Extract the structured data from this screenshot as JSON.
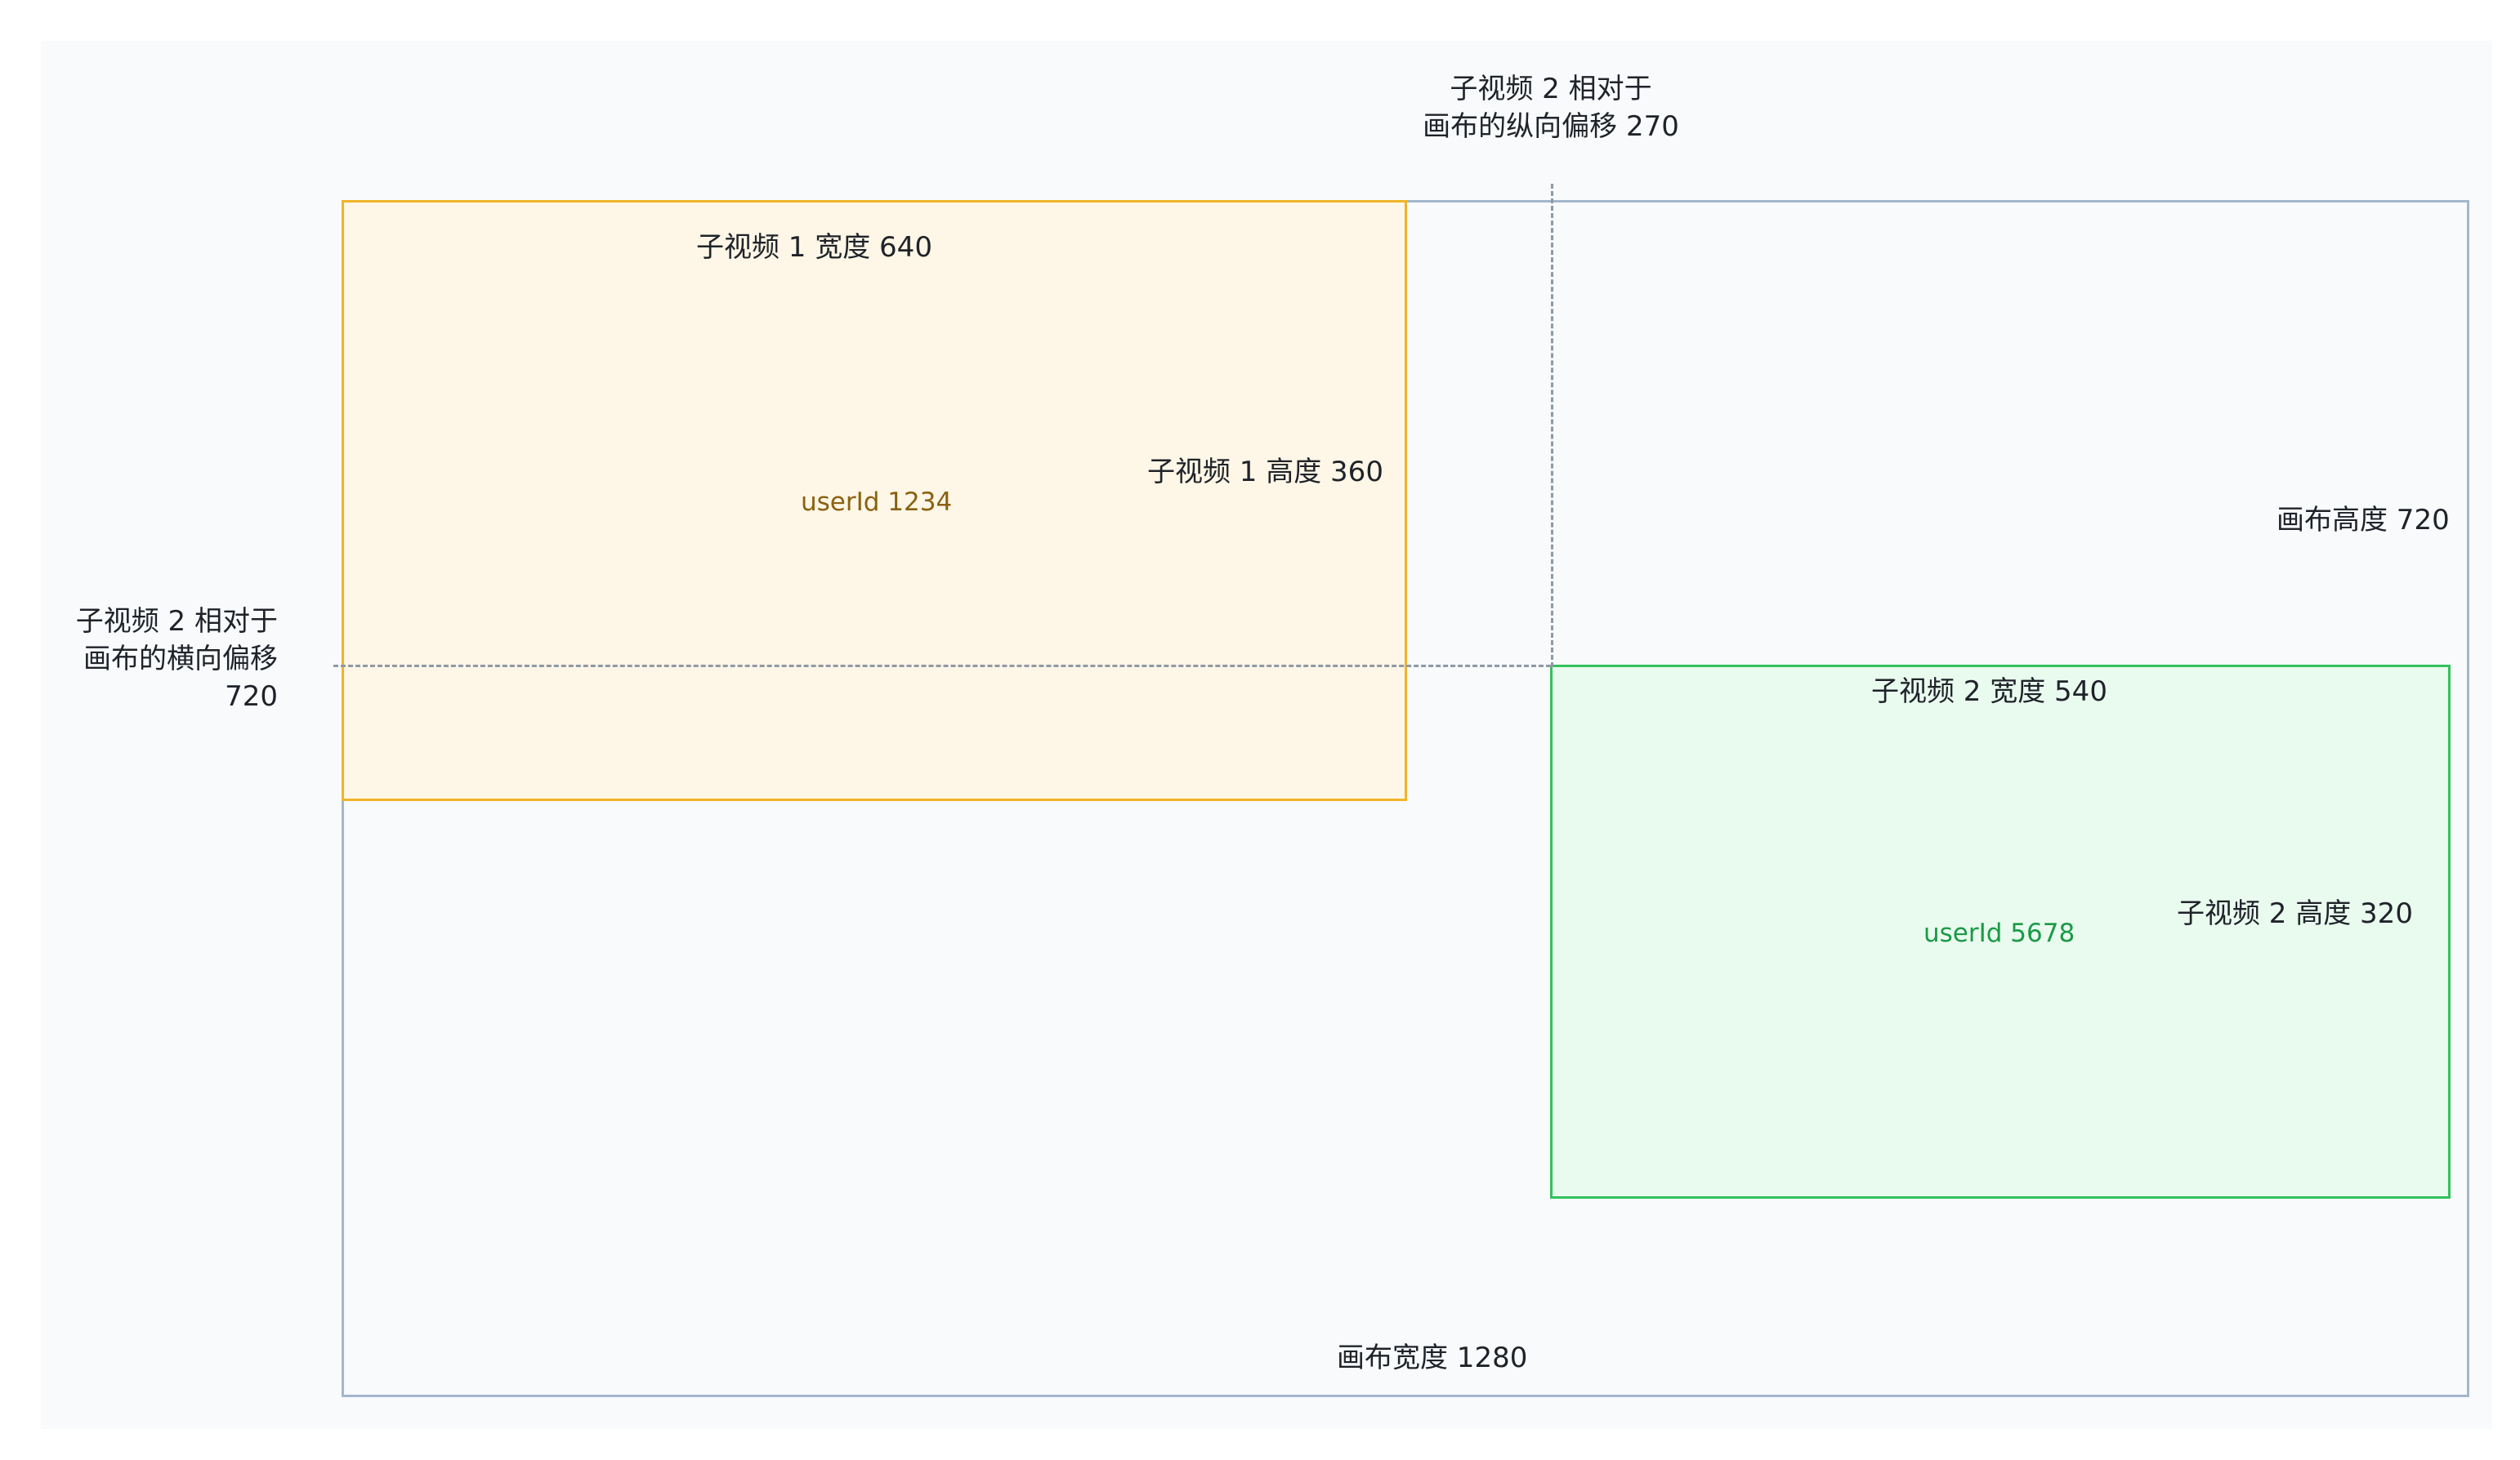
{
  "colors": {
    "panel_bg": "#f8fafc",
    "canvas_border": "#a4b6cb",
    "video1_border": "#f0b429",
    "video1_fill": "#fef6e6",
    "video2_border": "#34c15b",
    "video2_fill": "#e9faef",
    "guide_line": "#8e99a6"
  },
  "offsets": {
    "vertical_line1": "子视频 2 相对于",
    "vertical_line2": "画布的纵向偏移 270",
    "horizontal_line1": "子视频 2 相对于",
    "horizontal_line2": "画布的横向偏移",
    "horizontal_line3": "720"
  },
  "video1": {
    "width_label": "子视频 1 宽度 640",
    "height_label": "子视频 1 高度 360",
    "user_id": "userId 1234"
  },
  "video2": {
    "width_label": "子视频 2 宽度 540",
    "height_label": "子视频 2 高度 320",
    "user_id": "userId 5678"
  },
  "canvas": {
    "height_label": "画布高度 720",
    "width_label": "画布宽度 1280"
  }
}
